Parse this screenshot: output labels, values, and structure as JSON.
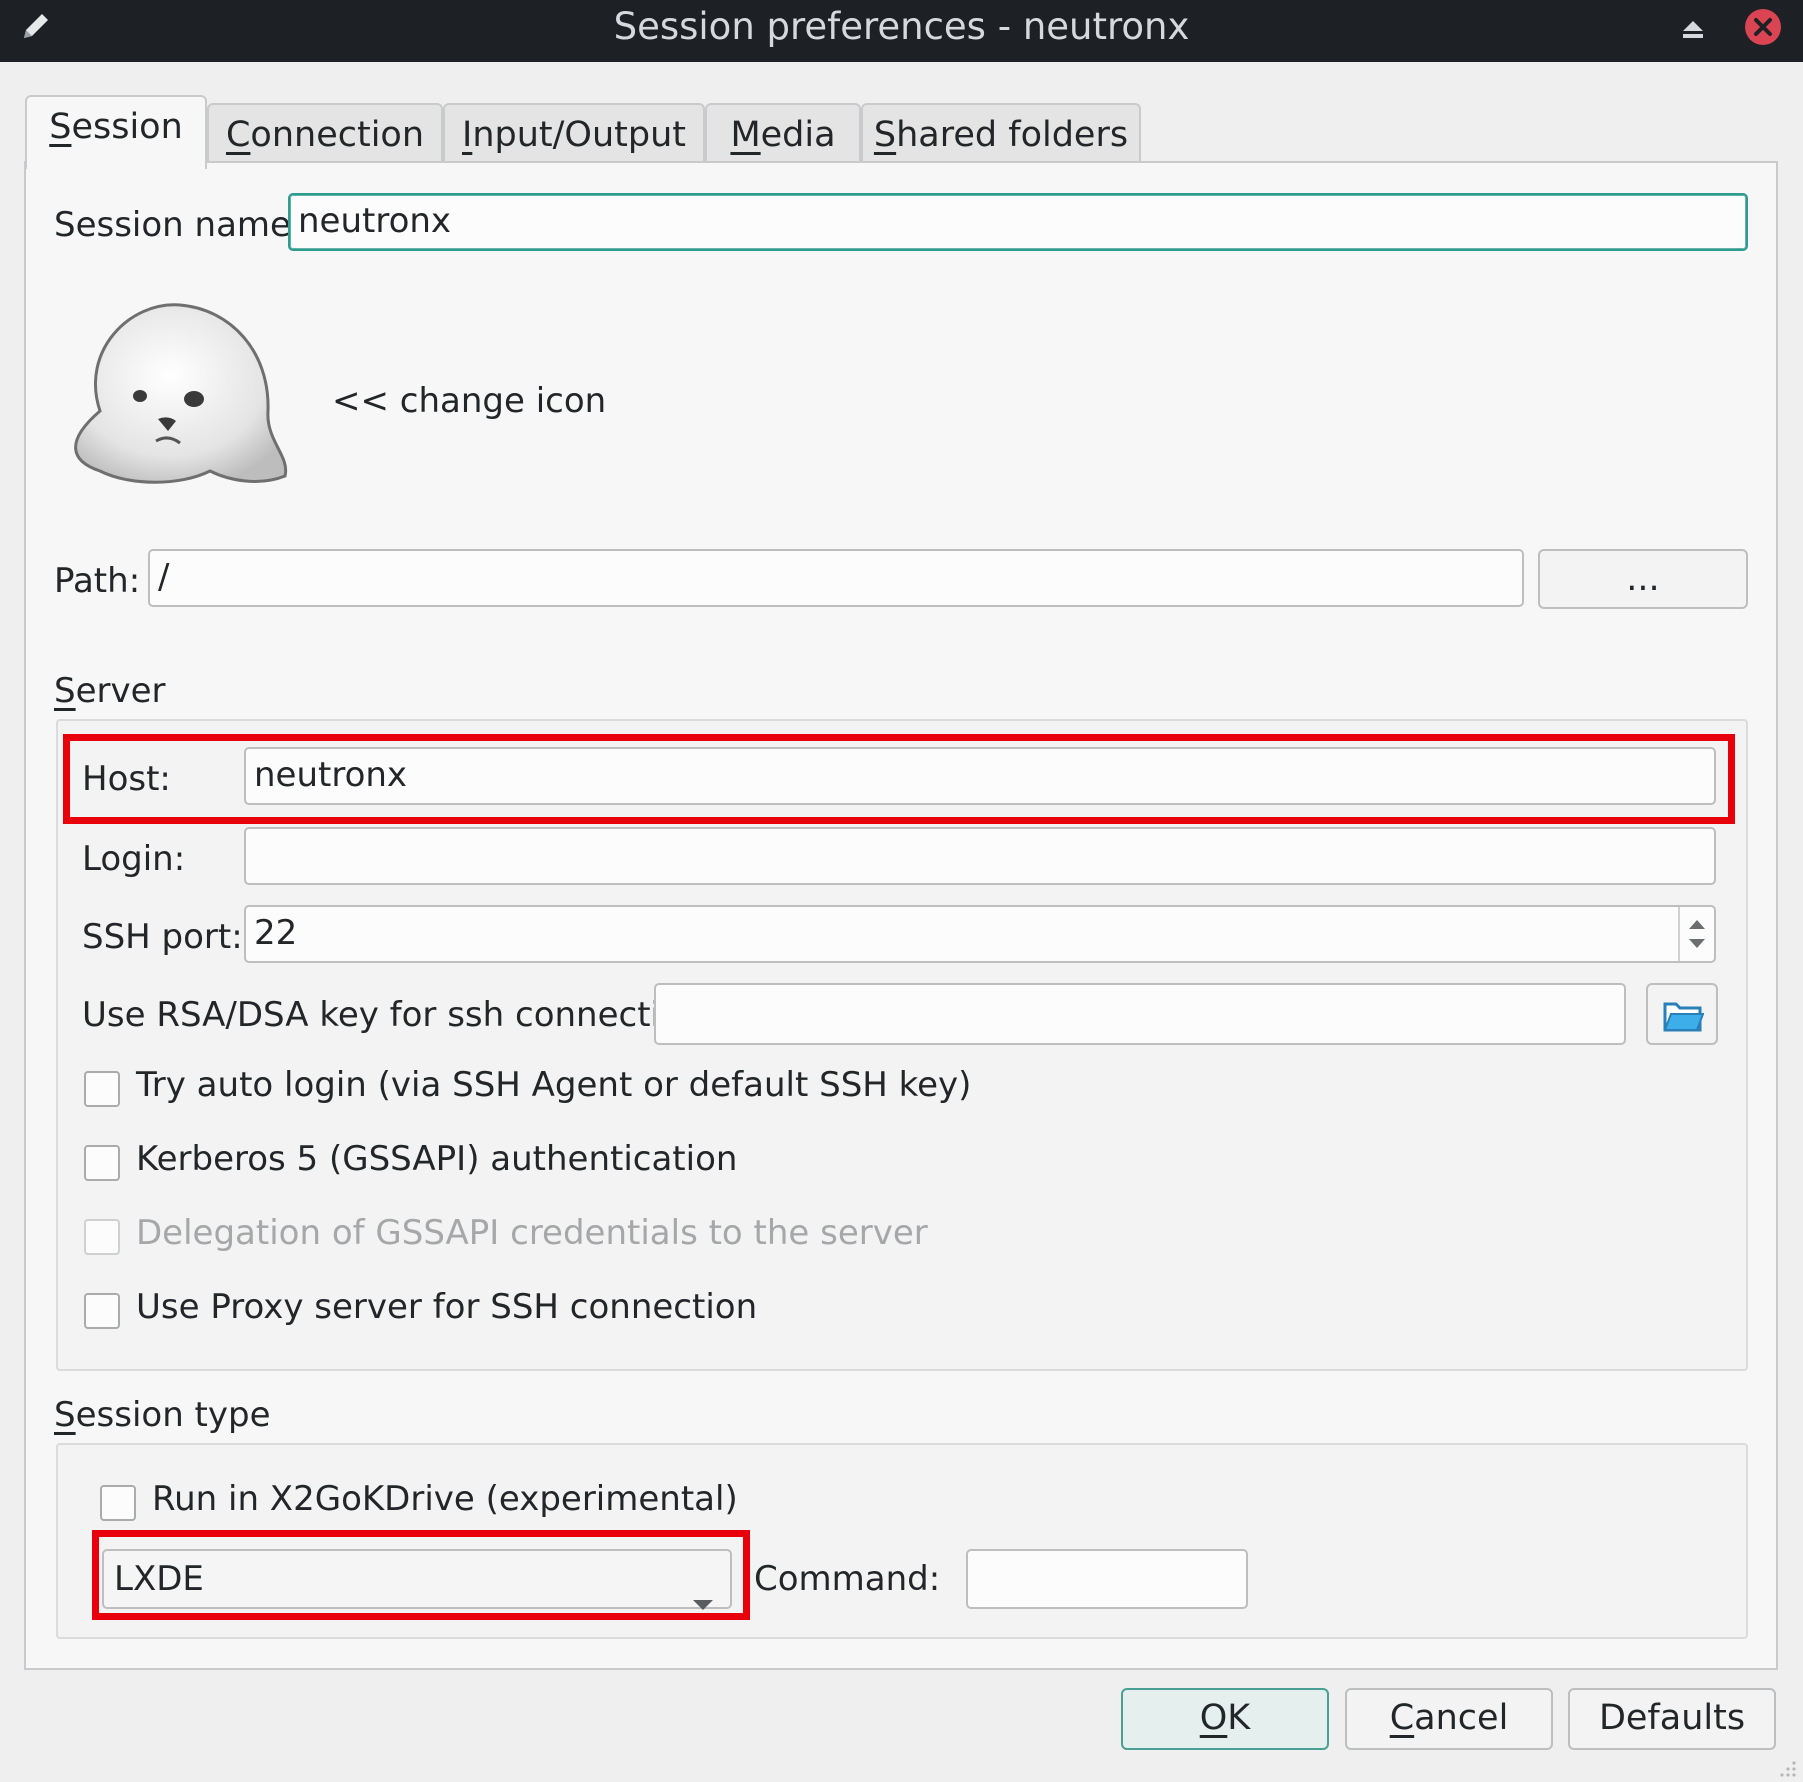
{
  "window": {
    "title": "Session preferences - neutronx"
  },
  "tabs": [
    {
      "label_ul": "S",
      "label_rest": "ession"
    },
    {
      "label_ul": "C",
      "label_rest": "onnection"
    },
    {
      "label_ul": "I",
      "label_rest": "nput/Output"
    },
    {
      "label_ul": "M",
      "label_rest": "edia"
    },
    {
      "label_ul": "S",
      "label_rest": "hared folders"
    }
  ],
  "session": {
    "name_label": "Session name:",
    "name_value": "neutronx",
    "change_icon_label": "<< change icon",
    "path_label": "Path:",
    "path_value": "/",
    "browse_label": "..."
  },
  "server": {
    "group_label_ul": "S",
    "group_label_rest": "erver",
    "host_label": "Host:",
    "host_value": "neutronx",
    "login_label": "Login:",
    "login_value": "",
    "ssh_port_label": "SSH port:",
    "ssh_port_value": "22",
    "rsa_label": "Use RSA/DSA key for ssh connection:",
    "rsa_value": "",
    "checkboxes": [
      {
        "label": "Try auto login (via SSH Agent or default SSH key)",
        "checked": false,
        "enabled": true
      },
      {
        "label": "Kerberos 5 (GSSAPI) authentication",
        "checked": false,
        "enabled": true
      },
      {
        "label": "Delegation of GSSAPI credentials to the server",
        "checked": false,
        "enabled": false
      },
      {
        "label": "Use Proxy server for SSH connection",
        "checked": false,
        "enabled": true
      }
    ]
  },
  "session_type": {
    "group_label_ul": "S",
    "group_label_rest": "ession type",
    "kdrive_label": "Run in X2GoKDrive (experimental)",
    "kdrive_checked": false,
    "type_value": "LXDE",
    "command_label": "Command:",
    "command_value": ""
  },
  "buttons": {
    "ok_ul": "O",
    "ok_rest": "K",
    "cancel_ul": "C",
    "cancel_rest": "ancel",
    "defaults": "Defaults"
  },
  "colors": {
    "highlight": "#e8000b",
    "titlebar": "#1d2125",
    "close": "#da4453"
  }
}
